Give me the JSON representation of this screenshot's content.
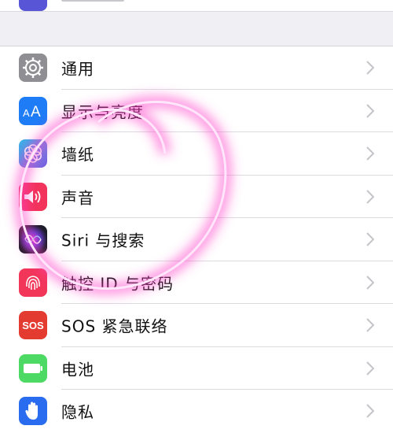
{
  "settings": {
    "items": [
      {
        "label": "通用",
        "icon": "gear-icon",
        "color": "#8e8e93"
      },
      {
        "label": "显示与亮度",
        "icon": "text-size-icon",
        "color": "#1e7cf6"
      },
      {
        "label": "墙纸",
        "icon": "flower-icon",
        "color": "#35a8e0"
      },
      {
        "label": "声音",
        "icon": "speaker-icon",
        "color": "#f2335b"
      },
      {
        "label": "Siri 与搜索",
        "icon": "siri-icon",
        "color": "#1f1f2b"
      },
      {
        "label": "触控 ID 与密码",
        "icon": "fingerprint-icon",
        "color": "#f2365a"
      },
      {
        "label": "SOS 紧急联络",
        "icon": "sos-icon",
        "color": "#e43b30",
        "badge": "SOS"
      },
      {
        "label": "电池",
        "icon": "battery-icon",
        "color": "#4cd964"
      },
      {
        "label": "隐私",
        "icon": "hand-icon",
        "color": "#2a6cf0"
      }
    ]
  },
  "annotation": {
    "color": "#ff3ec9"
  }
}
